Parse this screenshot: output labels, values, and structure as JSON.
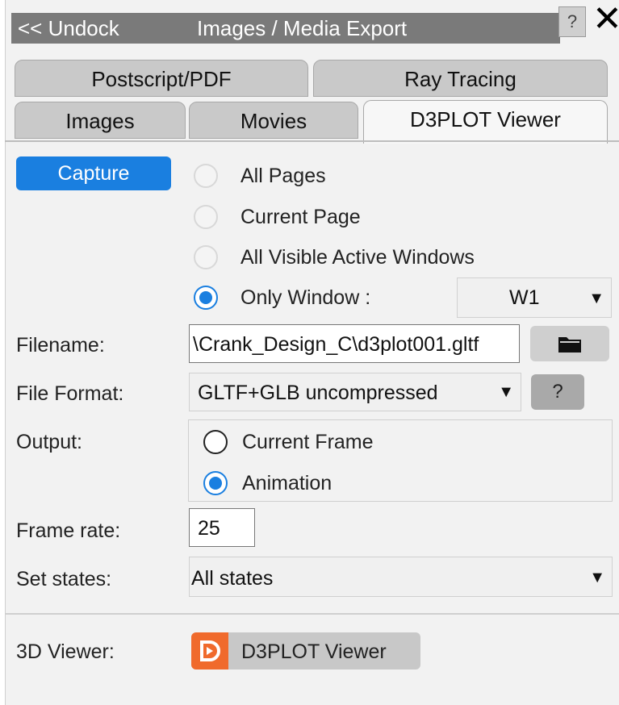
{
  "titlebar": {
    "undock": "<< Undock",
    "title": "Images / Media Export",
    "help": "?",
    "close": "✕"
  },
  "tabs_row1": [
    "Postscript/PDF",
    "Ray Tracing"
  ],
  "tabs_row2": [
    "Images",
    "Movies",
    "D3PLOT Viewer"
  ],
  "capture": {
    "button": "Capture",
    "options": [
      "All Pages",
      "Current Page",
      "All Visible Active Windows",
      "Only Window :"
    ],
    "selected_index": 3,
    "window_select": "W1"
  },
  "filename": {
    "label": "Filename:",
    "value": "\\Crank_Design_C\\d3plot001.gltf"
  },
  "file_format": {
    "label": "File Format:",
    "value": "GLTF+GLB uncompressed",
    "help": "?"
  },
  "output": {
    "label": "Output:",
    "options": [
      "Current Frame",
      "Animation"
    ],
    "selected_index": 1
  },
  "frame_rate": {
    "label": "Frame rate:",
    "value": "25"
  },
  "set_states": {
    "label": "Set states:",
    "value": "All states"
  },
  "viewer": {
    "label": "3D Viewer:",
    "button": "D3PLOT Viewer"
  },
  "colors": {
    "accent": "#1a7fe0",
    "title_bg": "#7a7a7a",
    "logo": "#f06a2c"
  }
}
